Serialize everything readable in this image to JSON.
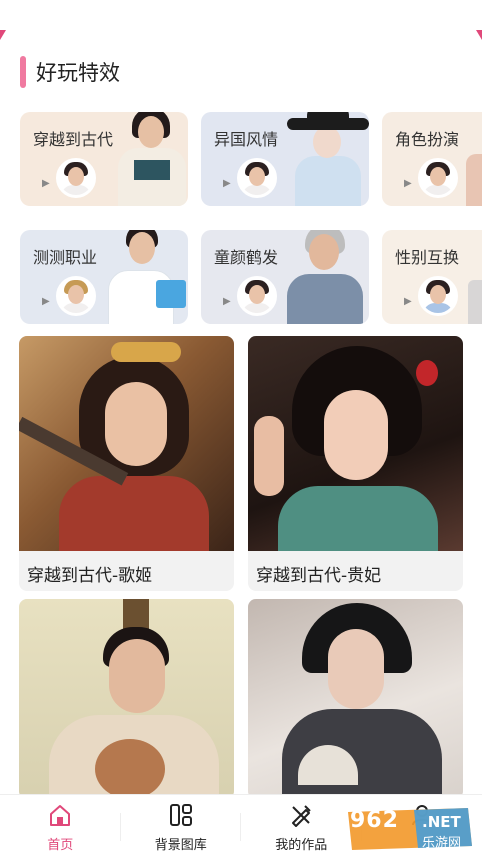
{
  "section": {
    "title": "好玩特效"
  },
  "effects": [
    {
      "label": "穿越到古代"
    },
    {
      "label": "异国风情"
    },
    {
      "label": "角色扮演"
    },
    {
      "label": "测测职业"
    },
    {
      "label": "童颜鹤发"
    },
    {
      "label": "性别互换"
    }
  ],
  "tiles": [
    {
      "caption": "穿越到古代-歌姬"
    },
    {
      "caption": "穿越到古代-贵妃"
    },
    {
      "caption": ""
    },
    {
      "caption": ""
    }
  ],
  "nav": {
    "items": [
      {
        "label": "首页",
        "icon": "home-icon",
        "active": true
      },
      {
        "label": "背景图库",
        "icon": "gallery-icon",
        "active": false
      },
      {
        "label": "我的作品",
        "icon": "brush-icon",
        "active": false
      },
      {
        "label": "",
        "icon": "profile-icon",
        "active": false
      }
    ]
  },
  "watermark": {
    "number": "962",
    "domain": ".NET",
    "text": "乐游网"
  },
  "colors": {
    "accent": "#e0487a",
    "section_bar": "#f07aa0"
  }
}
